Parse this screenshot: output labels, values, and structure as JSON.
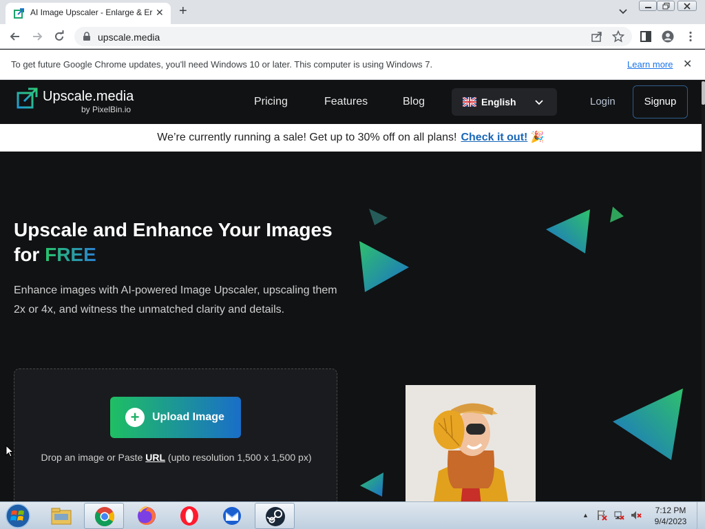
{
  "browser": {
    "tab_title": "AI Image Upscaler - Enlarge & Er",
    "url": "upscale.media",
    "infobar_message": "To get future Google Chrome updates, you'll need Windows 10 or later. This computer is using Windows 7.",
    "infobar_link": "Learn more"
  },
  "site": {
    "logo_name": "Upscale.media",
    "logo_by": "by PixelBin.io",
    "nav": [
      "Pricing",
      "Features",
      "Blog"
    ],
    "language": "English",
    "login": "Login",
    "signup": "Signup",
    "sale_text": "We’re currently running a sale! Get up to 30% off on all plans!",
    "sale_cta": "Check it out!",
    "sale_emoji": "🎉",
    "hero_title_line1": "Upscale and Enhance Your Images",
    "hero_title_for": "for",
    "hero_title_free": "FREE",
    "hero_desc": "Enhance images with AI-powered Image Upscaler, upscaling them 2x or 4x, and witness the unmatched clarity and details.",
    "upload_label": "Upload Image",
    "drop_prefix": "Drop an image or Paste",
    "drop_url": "URL",
    "drop_suffix": "(upto resolution 1,500 x 1,500 px)"
  },
  "taskbar": {
    "time": "7:12 PM",
    "date": "9/4/2023"
  },
  "colors": {
    "accent_green": "#1fbf63",
    "accent_blue": "#1a6ec8",
    "cta_blue": "#1866b8"
  }
}
